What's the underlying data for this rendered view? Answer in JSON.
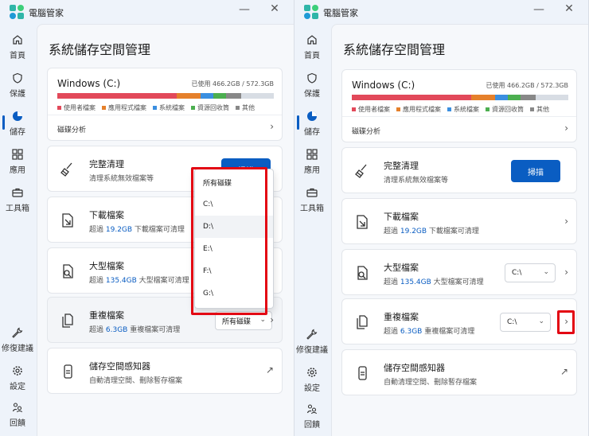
{
  "colors": {
    "accent": "#0a5dc2",
    "highlight": "#e30613",
    "apps": "#e2495a",
    "apps2": "#e5802b",
    "system": "#3b8fe0",
    "recycle": "#4caf50",
    "other": "#888888"
  },
  "app": {
    "title": "電腦管家",
    "minimize_icon": "—",
    "close_icon": "✕"
  },
  "nav": {
    "home": "首頁",
    "protect": "保護",
    "storage": "儲存",
    "apps": "應用",
    "toolbox": "工具箱",
    "repair": "修復建議",
    "settings": "設定",
    "feedback": "回饋"
  },
  "page": {
    "title": "系統儲存空間管理"
  },
  "drive": {
    "name": "Windows (C:)",
    "used": "已使用 466.2GB / 572.3GB",
    "analysis": "磁碟分析",
    "legend": {
      "apps": "使用者檔案",
      "apps_installed": "應用程式檔案",
      "system": "系統檔案",
      "recycle": "資源回收筒",
      "other": "其他"
    }
  },
  "cleanup": {
    "title": "完整清理",
    "sub": "清理系統無效檔案等",
    "scan": "掃描"
  },
  "downloads": {
    "title": "下載檔案",
    "sub_pre": "超過 ",
    "sub_val": "19.2GB",
    "sub_post": " 下載檔案可清理"
  },
  "large": {
    "title": "大型檔案",
    "sub_pre": "超過 ",
    "sub_val": "135.4GB",
    "sub_post": " 大型檔案可清理"
  },
  "duplicate": {
    "title": "重複檔案",
    "sub_pre": "超過 ",
    "sub_val": "6.3GB",
    "sub_post": " 重複檔案可清理"
  },
  "sense": {
    "title": "儲存空間感知器",
    "sub": "自動清理空間、刪除暫存檔案"
  },
  "left": {
    "duplicate_select": "所有磁碟"
  },
  "right": {
    "large_select": "C:\\",
    "duplicate_select": "C:\\"
  },
  "dropdown": {
    "options": [
      "所有磁碟",
      "C:\\",
      "D:\\",
      "E:\\",
      "F:\\",
      "G:\\"
    ]
  },
  "glyphs": {
    "chevron": "›",
    "caret": "⌄",
    "external": "↗"
  }
}
